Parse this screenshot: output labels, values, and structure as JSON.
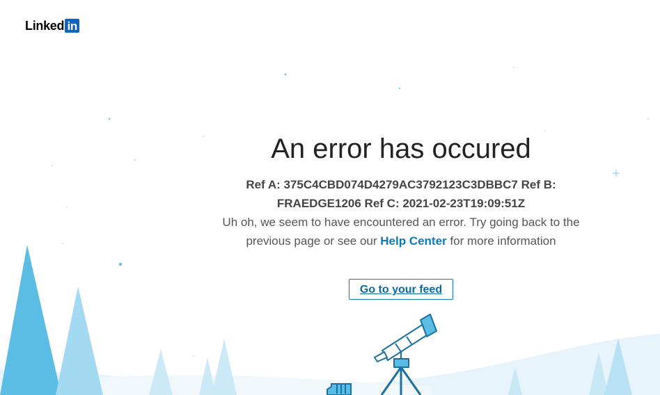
{
  "brand": {
    "logo_word": "Linked",
    "logo_box": "in",
    "accent_color": "#0a66c2",
    "link_color": "#0a7bb8"
  },
  "error": {
    "title": "An error has occured",
    "refs_line": "Ref A: 375C4CBD074D4279AC3792123C3DBBC7 Ref B: FRAEDGE1206 Ref C: 2021-02-23T19:09:51Z",
    "message_before": "Uh oh, we seem to have encountered an error. Try going back to the previous page or see our",
    "help_link": "Help Center",
    "message_after": "for more information"
  },
  "actions": {
    "feed_button": "Go to your feed"
  },
  "illustration": {
    "icons": [
      "pine-tree-icon",
      "telescope-icon",
      "snowflake-icon",
      "snow-hill-icon"
    ]
  }
}
